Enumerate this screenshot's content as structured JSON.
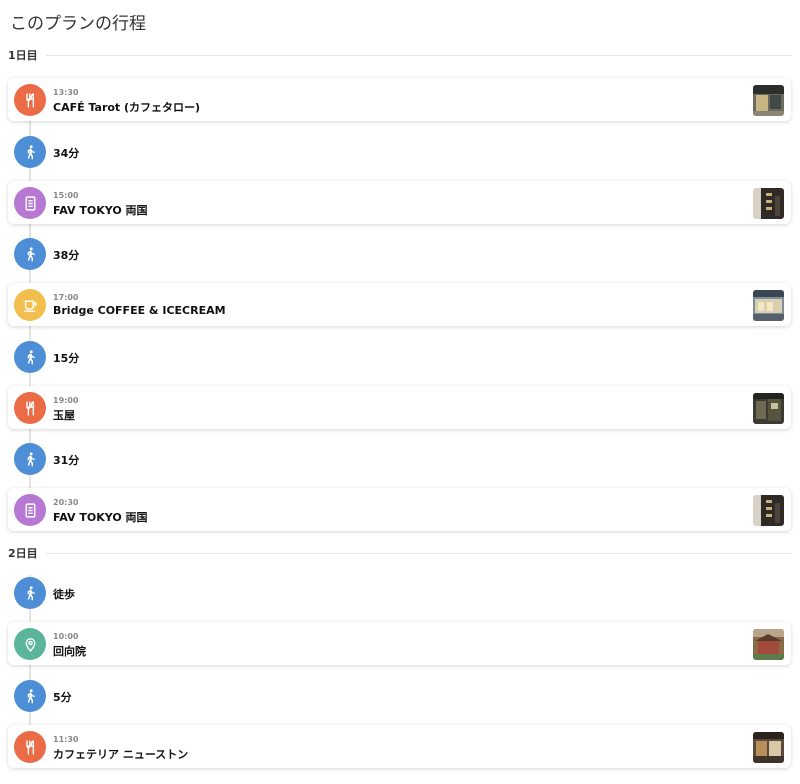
{
  "title": "このプランの行程",
  "colors": {
    "restaurant": "#ec6b47",
    "hotel": "#b678d2",
    "cafe": "#f2bf4e",
    "sightseeing": "#5bb59b",
    "walk": "#4e8ed6"
  },
  "days": [
    {
      "label": "1日目"
    },
    {
      "label": "2日目"
    }
  ],
  "items": [
    {
      "kind": "spot",
      "category": "restaurant",
      "icon": "fork-knife-icon",
      "time": "13:30",
      "name": "CAFÉ Tarot (カフェタロー)",
      "thumb": "cafe-photo"
    },
    {
      "kind": "move",
      "icon": "walk-icon",
      "duration": "34分"
    },
    {
      "kind": "spot",
      "category": "hotel",
      "icon": "hotel-icon",
      "time": "15:00",
      "name": "FAV TOKYO 両国",
      "thumb": "hotel-photo"
    },
    {
      "kind": "move",
      "icon": "walk-icon",
      "duration": "38分"
    },
    {
      "kind": "spot",
      "category": "cafe",
      "icon": "coffee-cup-icon",
      "time": "17:00",
      "name": "Bridge COFFEE & ICECREAM",
      "thumb": "coffee-shop-photo"
    },
    {
      "kind": "move",
      "icon": "walk-icon",
      "duration": "15分"
    },
    {
      "kind": "spot",
      "category": "restaurant",
      "icon": "fork-knife-icon",
      "time": "19:00",
      "name": "玉屋",
      "thumb": "restaurant-photo"
    },
    {
      "kind": "move",
      "icon": "walk-icon",
      "duration": "31分"
    },
    {
      "kind": "spot",
      "category": "hotel",
      "icon": "hotel-icon",
      "time": "20:30",
      "name": "FAV TOKYO 両国",
      "thumb": "hotel-photo"
    },
    {
      "kind": "move",
      "icon": "walk-icon",
      "duration": "徒歩"
    },
    {
      "kind": "spot",
      "category": "sightseeing",
      "icon": "map-pin-icon",
      "time": "10:00",
      "name": "回向院",
      "thumb": "temple-photo"
    },
    {
      "kind": "move",
      "icon": "walk-icon",
      "duration": "5分"
    },
    {
      "kind": "spot",
      "category": "restaurant",
      "icon": "fork-knife-icon",
      "time": "11:30",
      "name": "カフェテリア ニューストン",
      "thumb": "cafeteria-photo"
    }
  ]
}
